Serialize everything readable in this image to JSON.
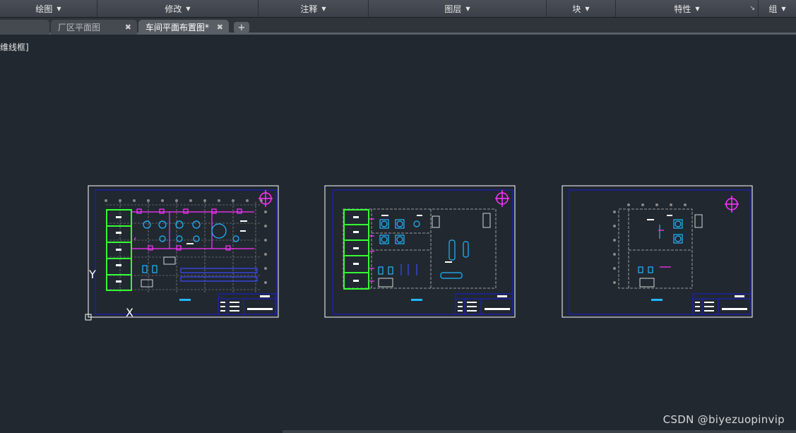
{
  "ribbon": {
    "panels": [
      {
        "label": "绘图"
      },
      {
        "label": "修改"
      },
      {
        "label": "注释"
      },
      {
        "label": "图层"
      },
      {
        "label": "块"
      },
      {
        "label": "特性"
      },
      {
        "label": "组"
      }
    ]
  },
  "tabs": [
    {
      "label": "",
      "state": "inactive"
    },
    {
      "label": "厂区平面图",
      "state": "inactive"
    },
    {
      "label": "车间平面布置图*",
      "state": "active"
    }
  ],
  "new_tab_label": "+",
  "viewport": {
    "label": "[-][俯视][二维线框]",
    "visible_label": "维线框]"
  },
  "ucs": {
    "x_label": "X",
    "y_label": "Y"
  },
  "watermark": "CSDN @biyezuopinvip",
  "colors": {
    "background": "#212830",
    "sheet_border": "#ffffff",
    "frame_border": "#1b1bd8",
    "magenta": "#ff33ff",
    "green": "#33ff33",
    "cyan": "#22b8ff"
  },
  "icons": [
    "dropdown-arrow-icon",
    "panel-launcher-icon",
    "close-icon",
    "plus-icon",
    "compass-icon",
    "ucs-icon"
  ]
}
